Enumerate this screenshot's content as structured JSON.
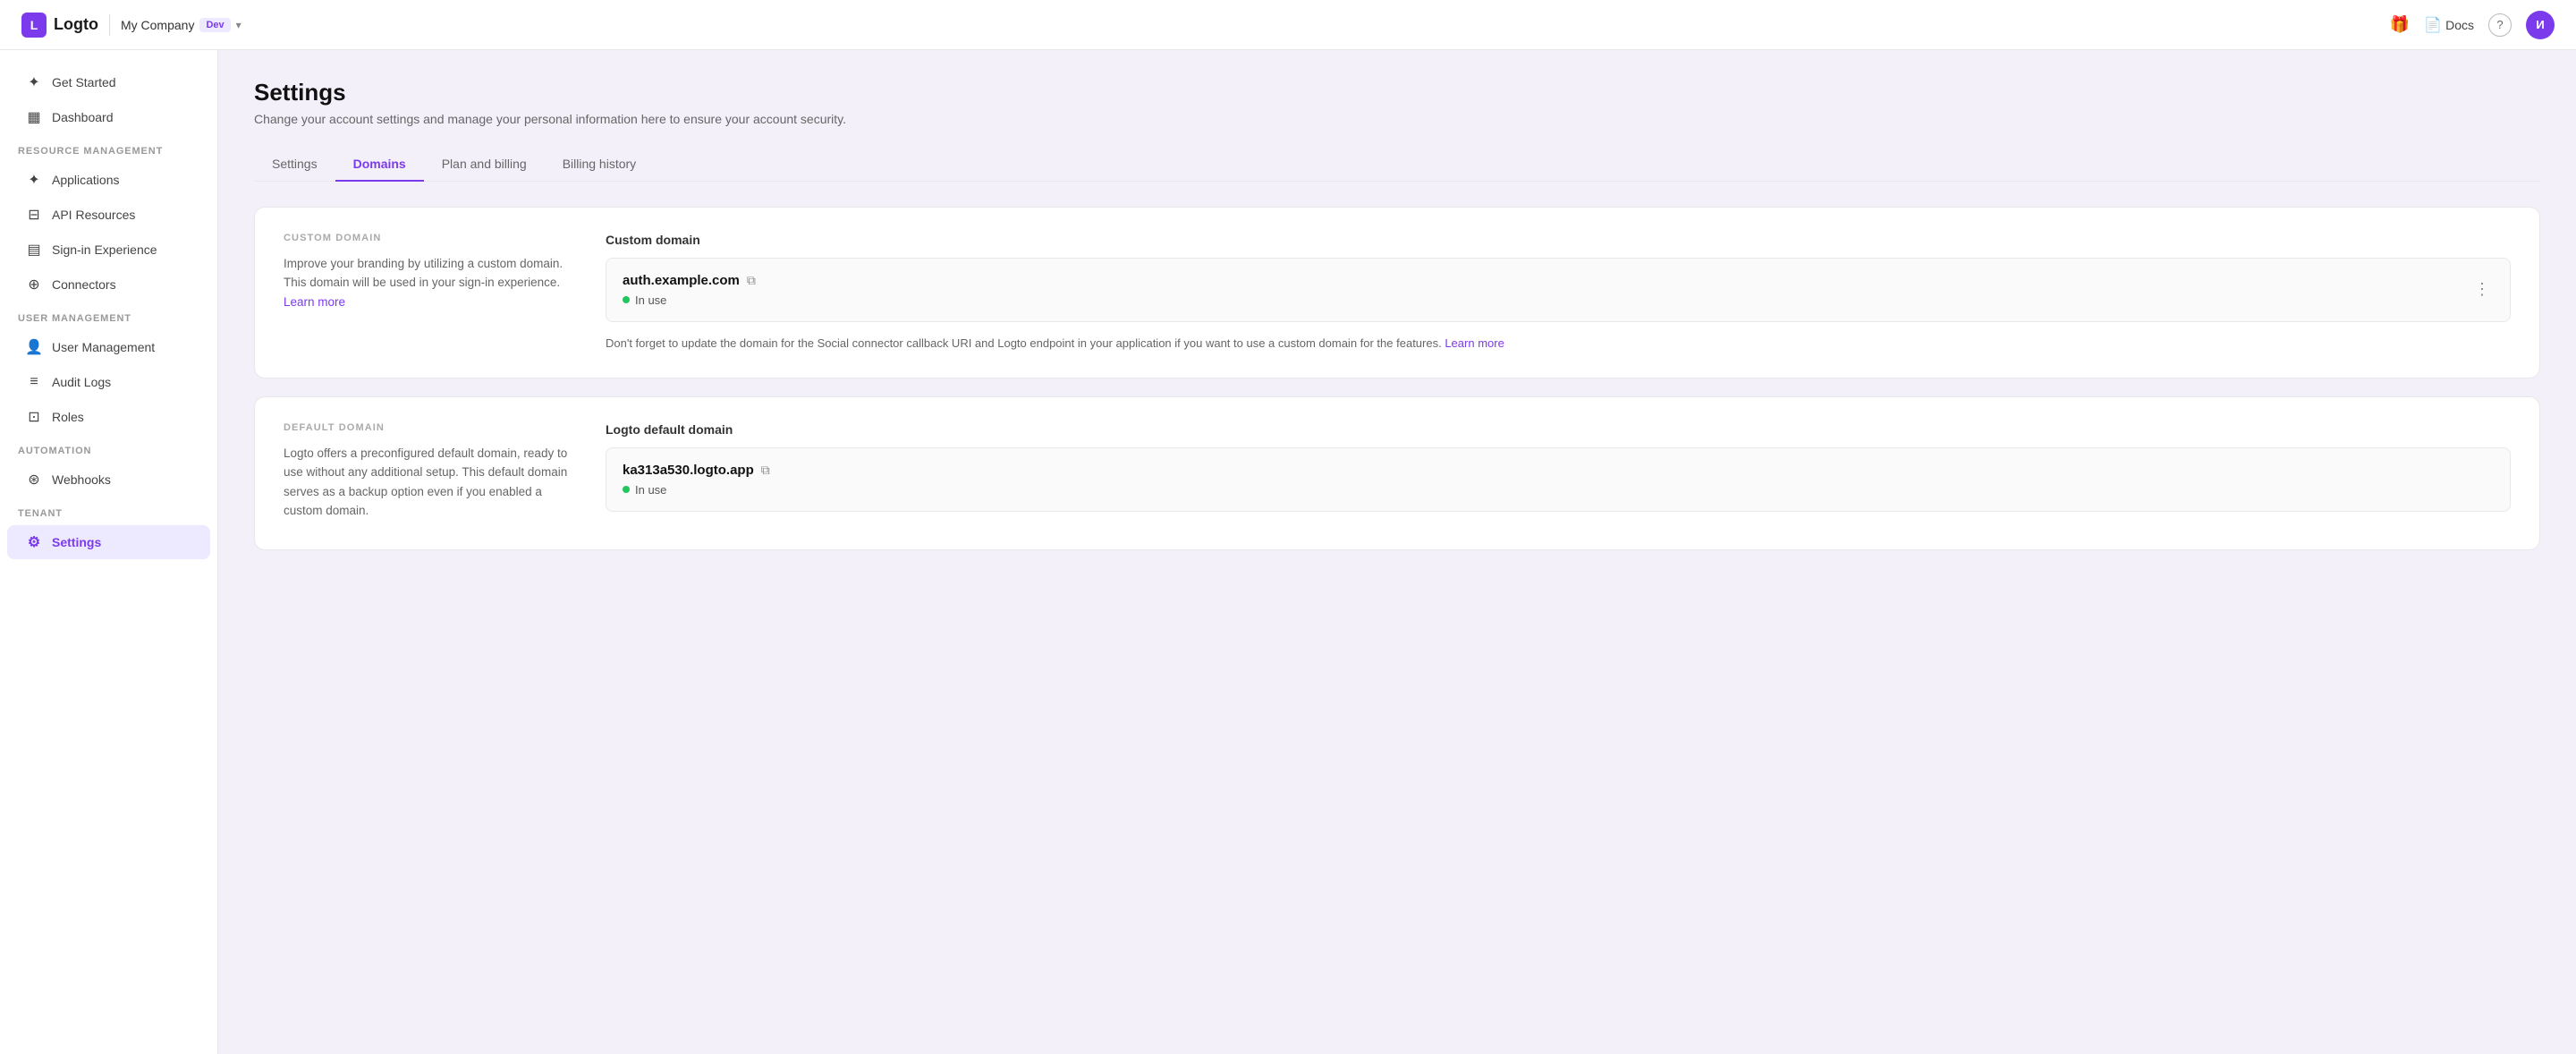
{
  "topbar": {
    "logo_text": "Logto",
    "tenant_name": "My Company",
    "tenant_env": "Dev",
    "gift_icon": "🎁",
    "docs_label": "Docs",
    "help_icon": "?",
    "avatar_label": "И"
  },
  "sidebar": {
    "get_started_label": "Get Started",
    "dashboard_label": "Dashboard",
    "resource_management_label": "Resource Management",
    "applications_label": "Applications",
    "api_resources_label": "API Resources",
    "sign_in_experience_label": "Sign-in Experience",
    "connectors_label": "Connectors",
    "user_management_section": "User Management",
    "user_management_label": "User Management",
    "audit_logs_label": "Audit Logs",
    "roles_label": "Roles",
    "automation_label": "Automation",
    "webhooks_label": "Webhooks",
    "tenant_label": "Tenant",
    "settings_label": "Settings"
  },
  "page": {
    "title": "Settings",
    "subtitle": "Change your account settings and manage your personal information here to ensure your account security."
  },
  "tabs": [
    {
      "id": "settings",
      "label": "Settings"
    },
    {
      "id": "domains",
      "label": "Domains",
      "active": true
    },
    {
      "id": "plan-billing",
      "label": "Plan and billing"
    },
    {
      "id": "billing-history",
      "label": "Billing history"
    }
  ],
  "custom_domain_card": {
    "section_label": "Custom Domain",
    "description": "Improve your branding by utilizing a custom domain. This domain will be used in your sign-in experience.",
    "learn_more_label": "Learn more",
    "right_title": "Custom domain",
    "domain_name": "auth.example.com",
    "status": "In use",
    "notice": "Don't forget to update the domain for the Social connector callback URI and Logto endpoint in your application if you want to use a custom domain for the features.",
    "notice_learn_more": "Learn more"
  },
  "default_domain_card": {
    "section_label": "Default Domain",
    "description": "Logto offers a preconfigured default domain, ready to use without any additional setup. This default domain serves as a backup option even if you enabled a custom domain.",
    "right_title": "Logto default domain",
    "domain_name": "ka313a530.logto.app",
    "status": "In use"
  }
}
